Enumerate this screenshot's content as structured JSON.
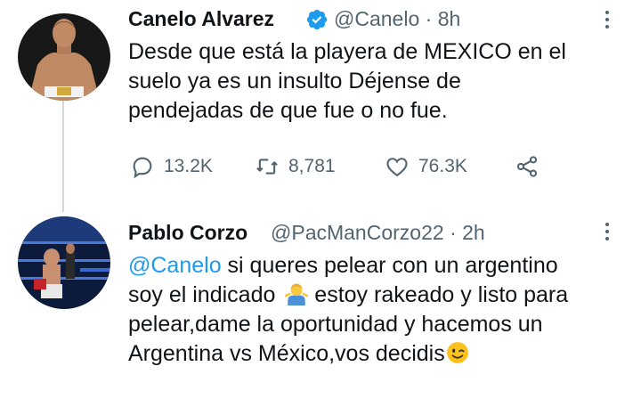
{
  "tweet": {
    "author_name": "Canelo Alvarez",
    "author_handle": "@Canelo",
    "separator": "·",
    "time": "8h",
    "lines": [
      "Desde que está la playera de MEXICO en el",
      "suelo ya es un insulto Déjense de",
      "pendejadas de que fue o no fue."
    ],
    "actions": {
      "replies": "13.2K",
      "retweets": "8,781",
      "likes": "76.3K"
    }
  },
  "reply": {
    "author_name": "Pablo Corzo",
    "author_handle": "@PacManCorzo22",
    "separator": "·",
    "time": "2h",
    "mention": "@Canelo",
    "line1_rest": " si queres pelear con un argentino",
    "line2_a": "soy el indicado",
    "line2_b": " estoy rakeado y listo para",
    "line3": "pelear,dame la oportunidad y hacemos un",
    "line4": "Argentina vs México,vos decidis"
  },
  "colors": {
    "accent": "#1d9bf0",
    "text": "#0f1419",
    "muted": "#536471",
    "thread_line": "#cfd9de"
  },
  "icons": [
    "verified-badge-icon",
    "more-options-icon",
    "reply-icon",
    "retweet-icon",
    "like-icon",
    "share-icon",
    "person-shrugging-emoji",
    "winking-face-emoji"
  ]
}
